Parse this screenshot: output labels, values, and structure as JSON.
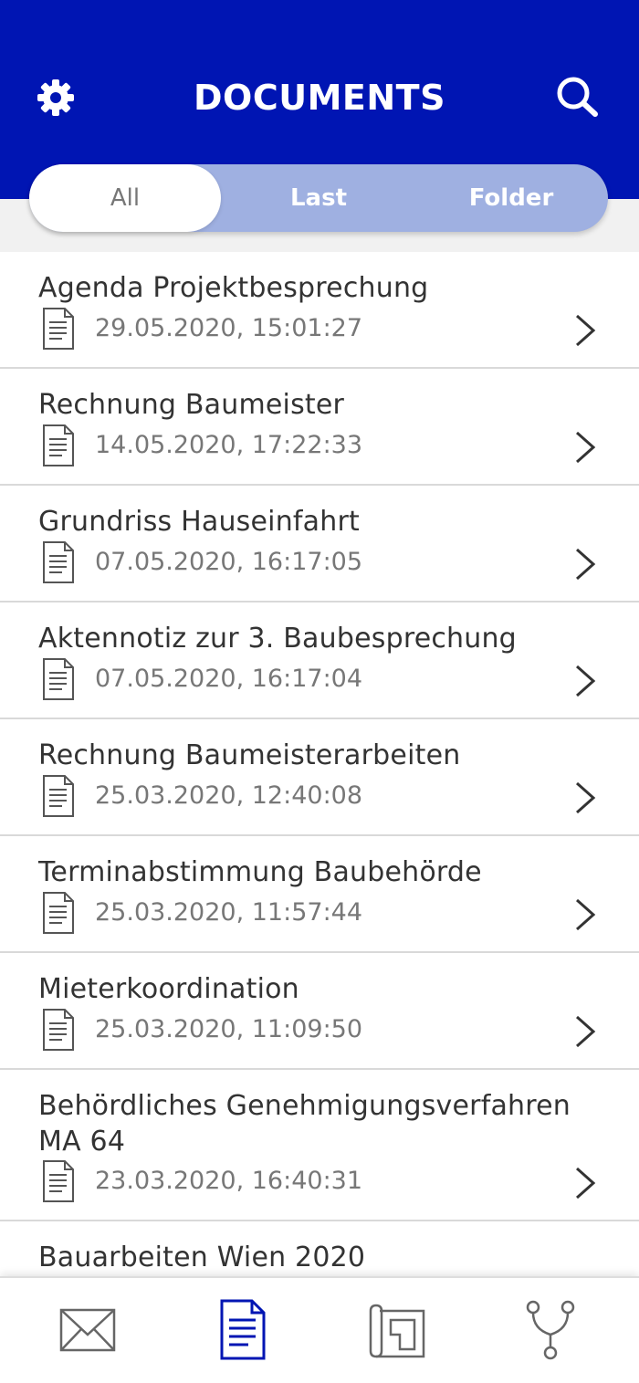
{
  "header": {
    "title": "DOCUMENTS",
    "settings_icon": "gear-icon",
    "search_icon": "search-icon",
    "background_color": "#0015b3"
  },
  "tabs": [
    {
      "label": "All",
      "active": true
    },
    {
      "label": "Last",
      "active": false
    },
    {
      "label": "Folder",
      "active": false
    }
  ],
  "documents": [
    {
      "title": "Agenda Projektbesprechung",
      "date": "29.05.2020, 15:01:27"
    },
    {
      "title": "Rechnung Baumeister",
      "date": "14.05.2020, 17:22:33"
    },
    {
      "title": "Grundriss Hauseinfahrt",
      "date": "07.05.2020, 16:17:05"
    },
    {
      "title": "Aktennotiz zur 3. Baubesprechung",
      "date": "07.05.2020, 16:17:04"
    },
    {
      "title": "Rechnung Baumeisterarbeiten",
      "date": "25.03.2020, 12:40:08"
    },
    {
      "title": "Terminabstimmung Baubehörde",
      "date": "25.03.2020, 11:57:44"
    },
    {
      "title": "Mieterkoordination",
      "date": "25.03.2020, 11:09:50"
    },
    {
      "title": "Behördliches Genehmigungsverfahren MA 64",
      "date": "23.03.2020, 16:40:31"
    },
    {
      "title": "Bauarbeiten Wien 2020",
      "date": ""
    }
  ],
  "bottom_nav": [
    {
      "icon": "envelope-icon",
      "active": false
    },
    {
      "icon": "document-icon",
      "active": true
    },
    {
      "icon": "floor-plan-icon",
      "active": false
    },
    {
      "icon": "branch-icon",
      "active": false
    }
  ],
  "colors": {
    "accent": "#0015b3",
    "tab_inactive_bg": "#9fb0e1",
    "text": "#333333",
    "muted": "#777777"
  }
}
